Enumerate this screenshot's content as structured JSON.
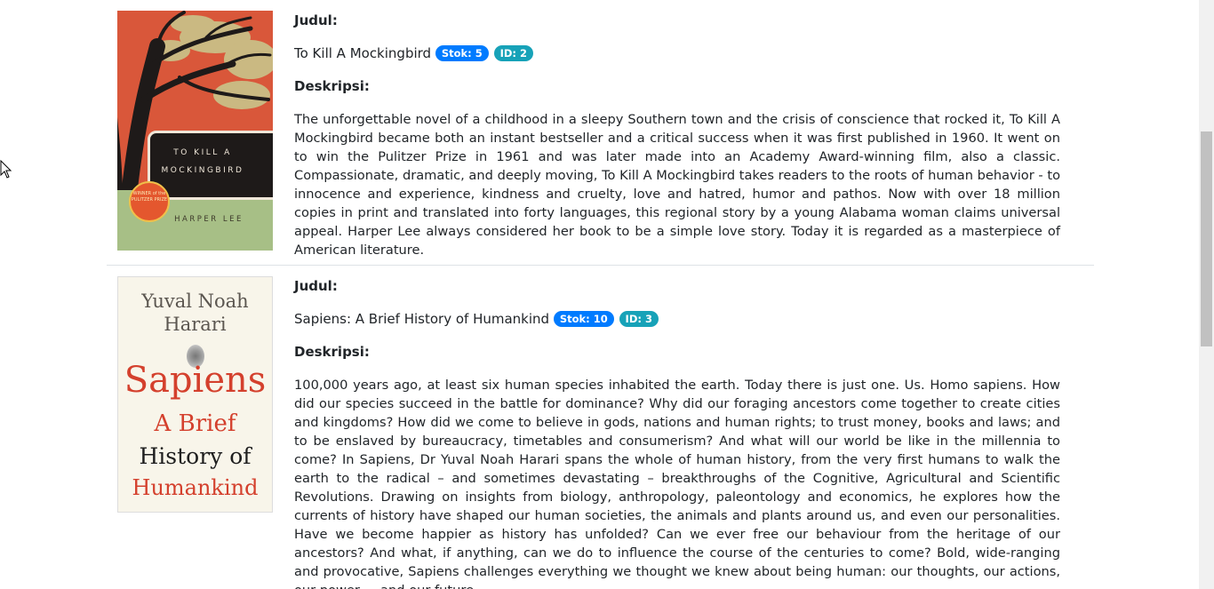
{
  "books": [
    {
      "label_title": "Judul:",
      "title": "To Kill A Mockingbird",
      "stock_badge": "Stok: 5",
      "id_badge": "ID: 2",
      "label_desc": "Deskripsi:",
      "description": "The unforgettable novel of a childhood in a sleepy Southern town and the crisis of conscience that rocked it, To Kill A Mockingbird became both an instant bestseller and a critical success when it was first published in 1960. It went on to win the Pulitzer Prize in 1961 and was later made into an Academy Award-winning film, also a classic. Compassionate, dramatic, and deeply moving, To Kill A Mockingbird takes readers to the roots of human behavior - to innocence and experience, kindness and cruelty, love and hatred, humor and pathos. Now with over 18 million copies in print and translated into forty languages, this regional story by a young Alabama woman claims universal appeal. Harper Lee always considered her book to be a simple love story. Today it is regarded as a masterpiece of American literature.",
      "cover": {
        "title_line1": "TO KILL A",
        "title_line2": "MOCKINGBIRD",
        "author": "HARPER LEE",
        "medal": "WINNER of the PULITZER PRIZE"
      }
    },
    {
      "label_title": "Judul:",
      "title": "Sapiens: A Brief History of Humankind",
      "stock_badge": "Stok: 10",
      "id_badge": "ID: 3",
      "label_desc": "Deskripsi:",
      "description": "100,000 years ago, at least six human species inhabited the earth. Today there is just one. Us. Homo sapiens. How did our species succeed in the battle for dominance? Why did our foraging ancestors come together to create cities and kingdoms? How did we come to believe in gods, nations and human rights; to trust money, books and laws; and to be enslaved by bureaucracy, timetables and consumerism? And what will our world be like in the millennia to come? In Sapiens, Dr Yuval Noah Harari spans the whole of human history, from the very first humans to walk the earth to the radical – and sometimes devastating – breakthroughs of the Cognitive, Agricultural and Scientific Revolutions. Drawing on insights from biology, anthropology, paleontology and economics, he explores how the currents of history have shaped our human societies, the animals and plants around us, and even our personalities. Have we become happier as history has unfolded? Can we ever free our behaviour from the heritage of our ancestors? And what, if anything, can we do to influence the course of the centuries to come? Bold, wide-ranging and provocative, Sapiens challenges everything we thought we knew about being human: our thoughts, our actions, our power ... and our future.",
      "cover": {
        "author_line1": "Yuval Noah",
        "author_line2": "Harari",
        "title": "Sapiens",
        "sub1": "A Brief",
        "sub2": "History of",
        "sub3": "Humankind"
      }
    }
  ],
  "colors": {
    "badge_stock": "#007bff",
    "badge_id": "#17a2b8",
    "divider": "#dee2e6"
  }
}
